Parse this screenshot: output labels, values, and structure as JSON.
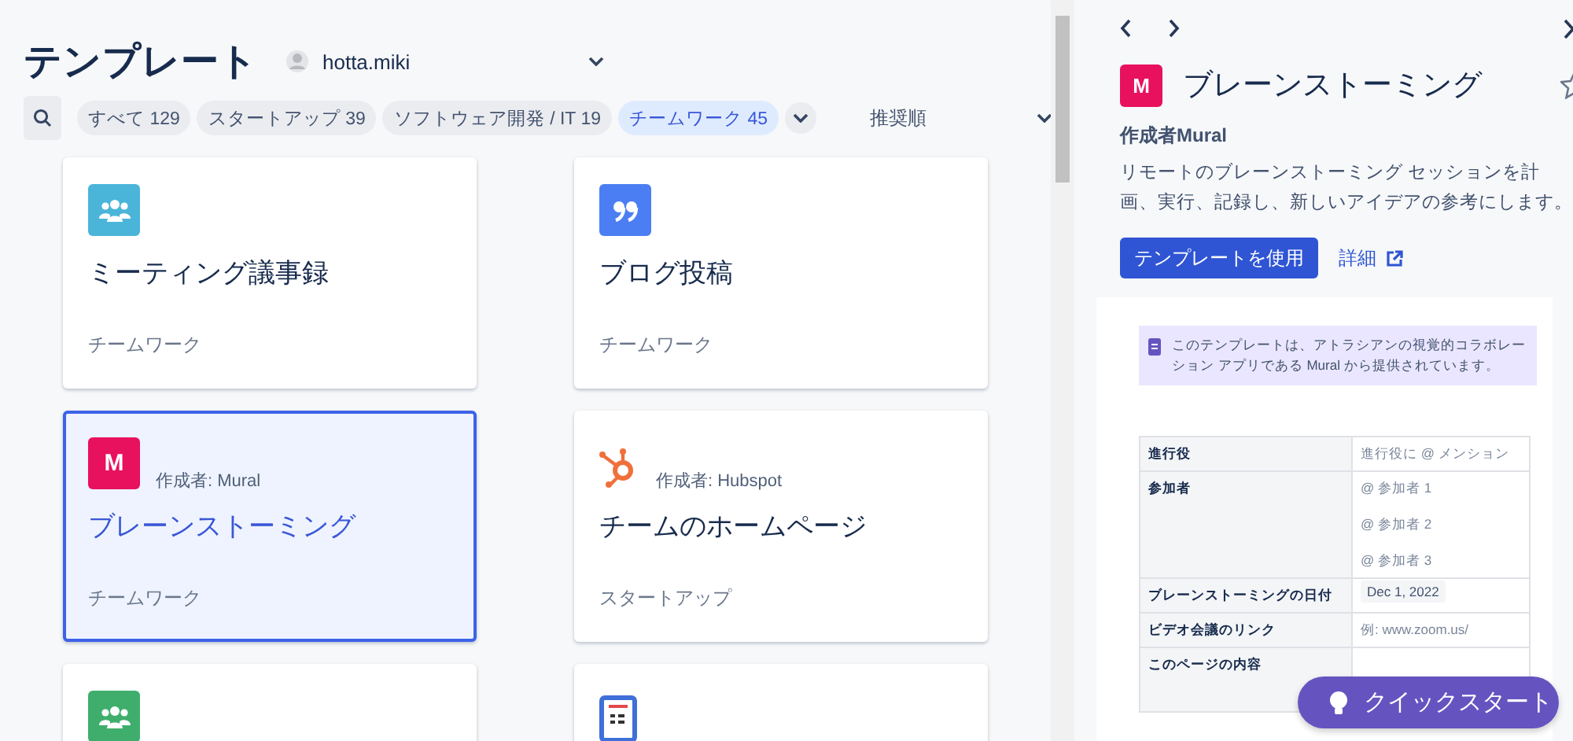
{
  "header": {
    "title": "テンプレート",
    "user": "hotta.miki"
  },
  "filters": [
    {
      "label": "すべて",
      "count": "129",
      "selected": false
    },
    {
      "label": "スタートアップ",
      "count": "39",
      "selected": false
    },
    {
      "label": "ソフトウェア開発 / IT",
      "count": "19",
      "selected": false
    },
    {
      "label": "チームワーク",
      "count": "45",
      "selected": true
    }
  ],
  "sort": "推奨順",
  "cards": [
    {
      "kind": "people",
      "color": "#4bb5d9",
      "title": "ミーティング議事録",
      "category": "チームワーク",
      "selected": false
    },
    {
      "kind": "quote",
      "color": "#4c7ef3",
      "title": "ブログ投稿",
      "category": "チームワーク",
      "selected": false
    },
    {
      "kind": "mural",
      "color": "#e8115e",
      "letter": "M",
      "author": "作成者: Mural",
      "title": "ブレーンストーミング",
      "category": "チームワーク",
      "selected": true
    },
    {
      "kind": "hubspot",
      "color": "#f0703c",
      "author": "作成者: Hubspot",
      "title": "チームのホームページ",
      "category": "スタートアップ",
      "selected": false
    },
    {
      "kind": "people",
      "color": "#3fae6c",
      "selected": false
    },
    {
      "kind": "document",
      "color": "#3f6fd8",
      "selected": false
    }
  ],
  "detail": {
    "logo": "M",
    "title": "ブレーンストーミング",
    "author": "作成者Mural",
    "description": "リモートのブレーンストーミング セッションを計画、実行、記録し、新しいアイデアの参考にします。",
    "use_button": "テンプレートを使用",
    "more_link": "詳細",
    "info": "このテンプレートは、アトラシアンの視覚的コラボレーション アプリである Mural から提供されています。",
    "table": [
      {
        "label": "進行役",
        "kind": "placeholder",
        "values": [
          "進行役に @ メンション"
        ]
      },
      {
        "label": "参加者",
        "kind": "placeholder",
        "values": [
          "@ 参加者 1",
          "@ 参加者 2",
          "@ 参加者 3"
        ]
      },
      {
        "label": "ブレーンストーミングの日付",
        "kind": "date",
        "values": [
          "Dec 1, 2022"
        ]
      },
      {
        "label": "ビデオ会議のリンク",
        "kind": "placeholder",
        "values": [
          "例: www.zoom.us/"
        ]
      },
      {
        "label": "このページの内容"
      }
    ]
  },
  "quickstart": "クイックスタート"
}
